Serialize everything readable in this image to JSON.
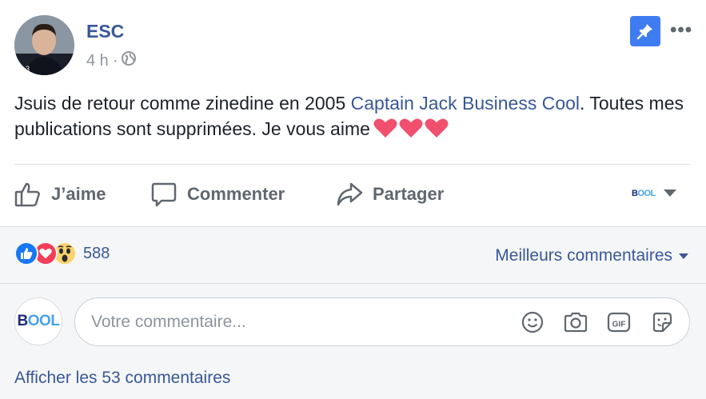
{
  "post": {
    "author": "ESC",
    "time": "4 h",
    "separator": "·",
    "text_before_link": "Jsuis de retour comme zinedine en 2005 ",
    "link_text": "Captain Jack Business Cool",
    "text_after_link": ". Toutes mes publications sont supprimées. Je vous aime",
    "privacy_icon": "globe-icon",
    "colors": {
      "link": "#385898",
      "pin": "#3f7cf1",
      "heart": "#f0506e"
    }
  },
  "actions": {
    "like_label": "J’aime",
    "comment_label": "Commenter",
    "share_label": "Partager",
    "page_logo_b": "B",
    "page_logo_rest": "OOL"
  },
  "reactions": {
    "count": "588",
    "types": [
      "like",
      "love",
      "wow"
    ]
  },
  "comments": {
    "sort_label": "Meilleurs commentaires",
    "placeholder": "Votre commentaire...",
    "avatar_logo_b": "B",
    "avatar_logo_rest": "OOL",
    "view_more": "Afficher les 53 commentaires",
    "tools": [
      "emoji-icon",
      "camera-icon",
      "gif-icon",
      "sticker-icon"
    ]
  }
}
